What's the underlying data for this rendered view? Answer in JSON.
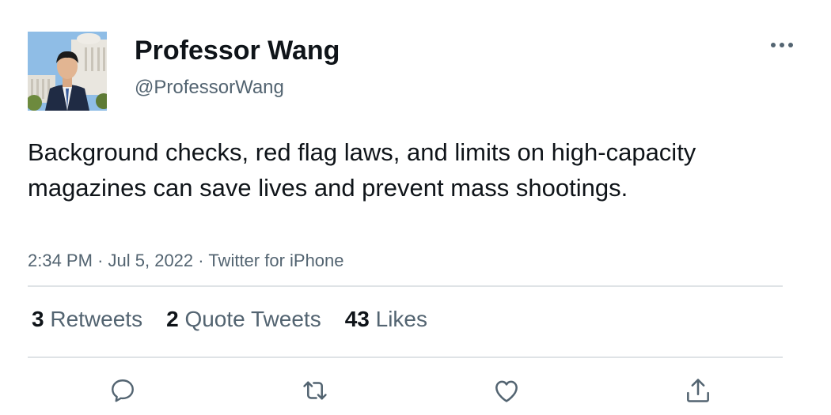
{
  "author": {
    "display_name": "Professor Wang",
    "handle": "@ProfessorWang",
    "avatar_icon": "profile-photo"
  },
  "menu": {
    "icon": "more-horizontal-icon",
    "glyph": "•••"
  },
  "tweet": {
    "text": "Background checks, red flag laws, and limits on high-capacity magazines can save lives and prevent mass shootings.",
    "time": "2:34 PM",
    "date": "Jul 5, 2022",
    "source": "Twitter for iPhone",
    "separator": "·"
  },
  "stats": {
    "retweets": {
      "count": "3",
      "label": "Retweets"
    },
    "quotes": {
      "count": "2",
      "label": "Quote Tweets"
    },
    "likes": {
      "count": "43",
      "label": "Likes"
    }
  },
  "actions": [
    "reply-icon",
    "retweet-icon",
    "like-icon",
    "share-icon"
  ],
  "colors": {
    "text": "#0f1419",
    "secondary": "#536471",
    "divider": "#dfe3e6"
  }
}
